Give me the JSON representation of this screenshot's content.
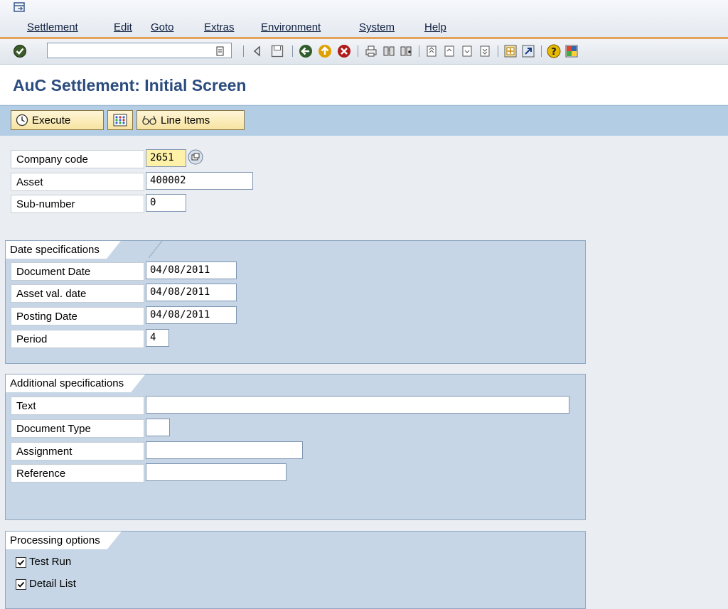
{
  "menu": {
    "items": [
      {
        "label": "Settlement"
      },
      {
        "label": "Edit"
      },
      {
        "label": "Goto"
      },
      {
        "label": "Extras"
      },
      {
        "label": "Environment"
      },
      {
        "label": "System"
      },
      {
        "label": "Help"
      }
    ]
  },
  "toolbar": {
    "command_value": "",
    "icons": [
      "enter-icon",
      "save-icon",
      "back-icon",
      "exit-icon",
      "cancel-icon",
      "print-icon",
      "find-icon",
      "find-next-icon",
      "first-page-icon",
      "previous-page-icon",
      "next-page-icon",
      "last-page-icon",
      "create-session-icon",
      "shortcut-icon",
      "help-icon",
      "layout-icon"
    ]
  },
  "title": "AuC Settlement: Initial Screen",
  "app_toolbar": {
    "execute_label": "Execute",
    "line_items_label": "Line Items"
  },
  "header_fields": {
    "company_code": {
      "label": "Company code",
      "value": "2651"
    },
    "asset": {
      "label": "Asset",
      "value": "400002"
    },
    "sub_number": {
      "label": "Sub-number",
      "value": "0"
    }
  },
  "date_specifications": {
    "title": "Date specifications",
    "document_date": {
      "label": "Document Date",
      "value": "04/08/2011"
    },
    "asset_val_date": {
      "label": "Asset val. date",
      "value": "04/08/2011"
    },
    "posting_date": {
      "label": "Posting Date",
      "value": "04/08/2011"
    },
    "period": {
      "label": "Period",
      "value": "4"
    }
  },
  "additional_specifications": {
    "title": "Additional specifications",
    "text": {
      "label": "Text",
      "value": ""
    },
    "document_type": {
      "label": "Document Type",
      "value": ""
    },
    "assignment": {
      "label": "Assignment",
      "value": ""
    },
    "reference": {
      "label": "Reference",
      "value": ""
    }
  },
  "processing_options": {
    "title": "Processing options",
    "test_run": {
      "label": "Test Run",
      "checked": true
    },
    "detail_list": {
      "label": "Detail List",
      "checked": true
    }
  },
  "colors": {
    "title": "#2b4c7e",
    "app_toolbar": "#b3cde4",
    "group_bg": "#c6d6e6",
    "required_field": "#fff2a8",
    "menu_accent": "#e4a35a"
  }
}
